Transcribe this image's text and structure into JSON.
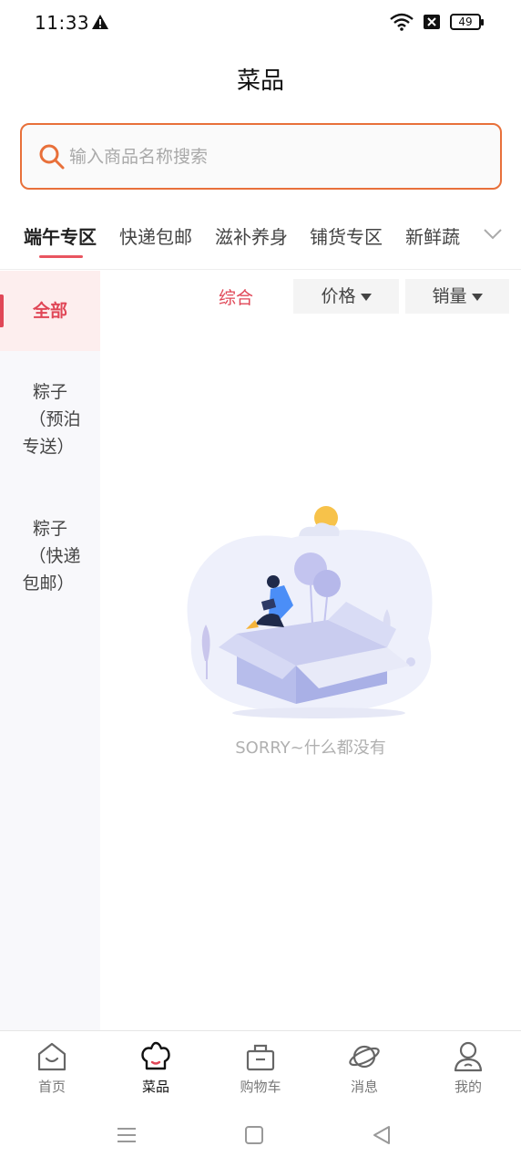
{
  "status_bar": {
    "time": "11:33",
    "battery": "49"
  },
  "header": {
    "title": "菜品"
  },
  "search": {
    "placeholder": "输入商品名称搜索"
  },
  "category_tabs": [
    {
      "label": "端午专区",
      "active": true
    },
    {
      "label": "快递包邮",
      "active": false
    },
    {
      "label": "滋补养身",
      "active": false
    },
    {
      "label": "铺货专区",
      "active": false
    },
    {
      "label": "新鲜蔬",
      "active": false
    }
  ],
  "sidebar": {
    "items": [
      {
        "label": "全部",
        "active": true
      },
      {
        "label_lines": [
          "粽子",
          "（预泊",
          "专送）"
        ],
        "active": false
      },
      {
        "label_lines": [
          "粽子",
          "（快递",
          "包邮）"
        ],
        "active": false
      }
    ]
  },
  "sort_bar": {
    "comprehensive": "综合",
    "price": "价格",
    "sales": "销量"
  },
  "empty_state": {
    "message": "SORRY~什么都没有"
  },
  "bottom_nav": [
    {
      "label": "首页",
      "icon": "home-icon",
      "active": false
    },
    {
      "label": "菜品",
      "icon": "chef-hat-icon",
      "active": true
    },
    {
      "label": "购物车",
      "icon": "basket-icon",
      "active": false
    },
    {
      "label": "消息",
      "icon": "planet-icon",
      "active": false
    },
    {
      "label": "我的",
      "icon": "user-icon",
      "active": false
    }
  ],
  "colors": {
    "accent": "#e04757",
    "search_border": "#e8703a",
    "sidebar_bg": "#f8f8fb"
  }
}
